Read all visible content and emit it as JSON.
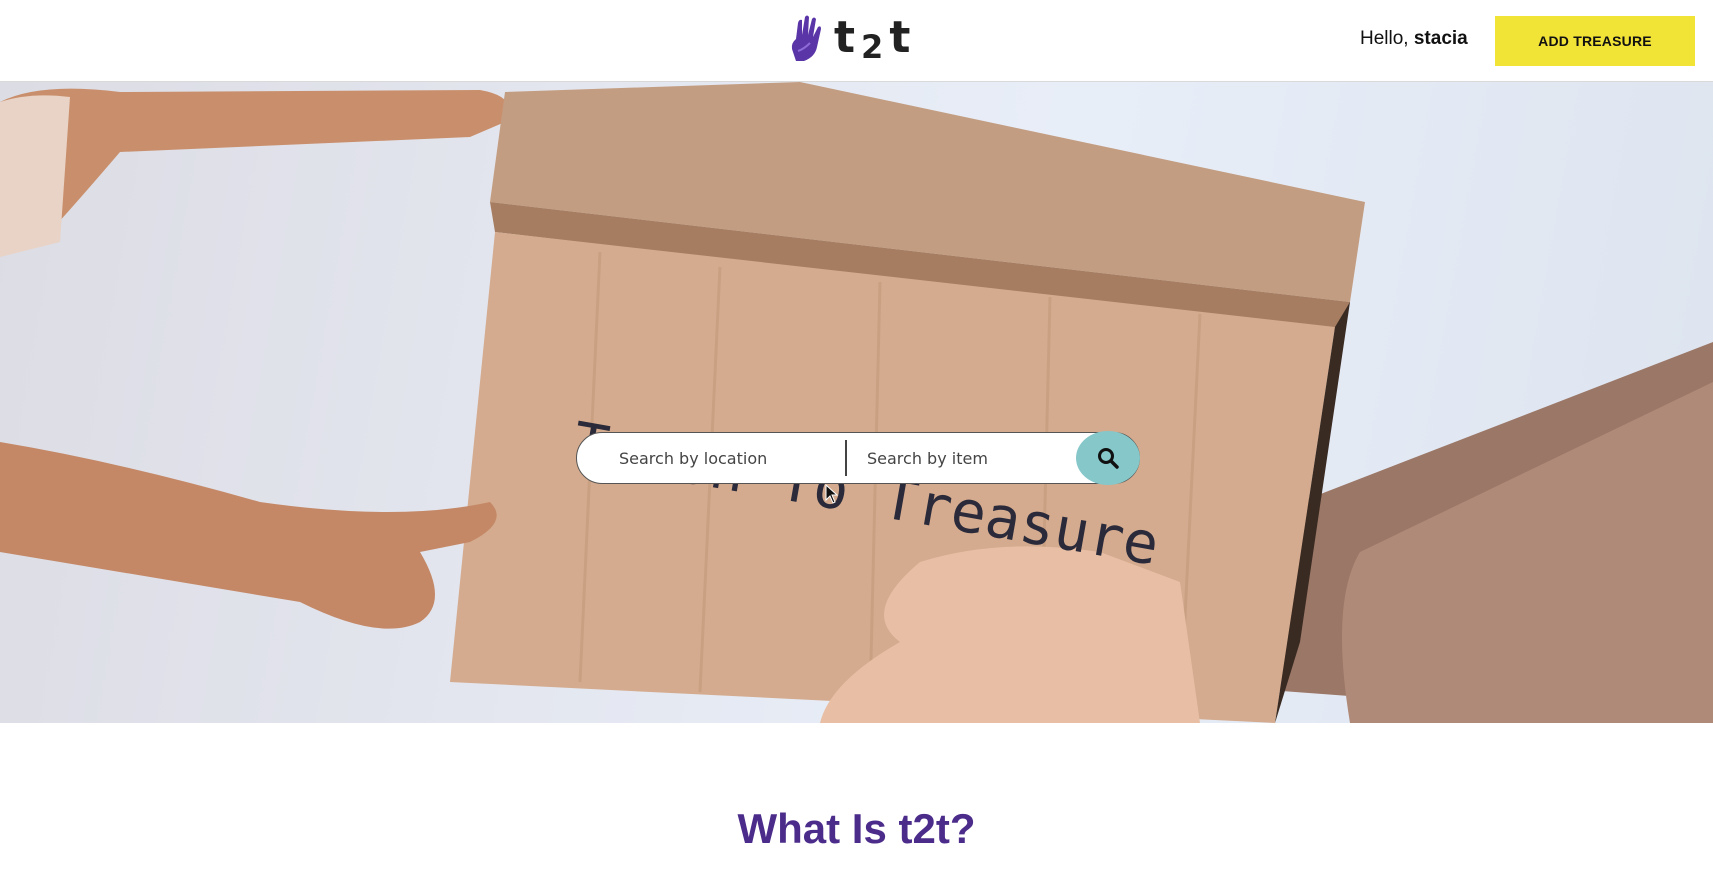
{
  "header": {
    "logo_text_left": "t",
    "logo_text_mid": "2",
    "logo_text_right": "t",
    "greeting_prefix": "Hello,",
    "username": "stacia",
    "add_button_label": "ADD TREASURE"
  },
  "hero": {
    "box_text": "Trash To Treasure",
    "search": {
      "location_placeholder": "Search by location",
      "item_placeholder": "Search by item",
      "button_icon": "search-icon"
    }
  },
  "about": {
    "title": "What Is t2t?"
  },
  "colors": {
    "accent_yellow": "#f2e337",
    "search_button": "#86c7c9",
    "brand_purple": "#4b2c8a",
    "logo_purple": "#5a35a8"
  }
}
